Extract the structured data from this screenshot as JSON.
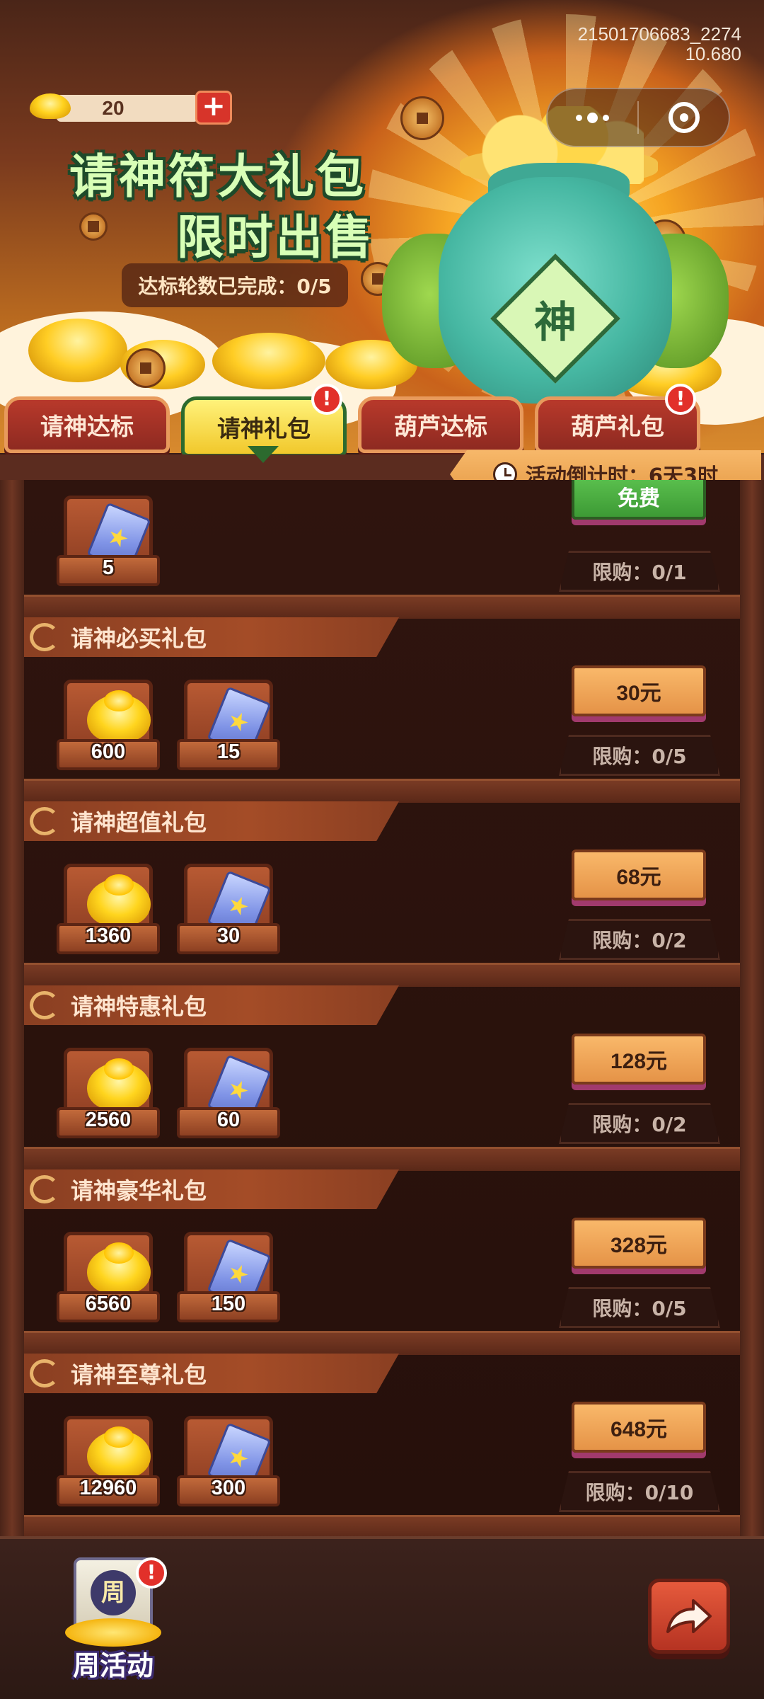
{
  "debug": {
    "line1": "21501706683_2274",
    "line2": "10.680"
  },
  "currency": {
    "amount": "20",
    "plus_label": "+"
  },
  "banner": {
    "title_line1": "请神符大礼包",
    "title_line2": "限时出售",
    "progress_text": "达标轮数已完成：0/5",
    "bag_label": "神"
  },
  "tabs": [
    {
      "label": "请神达标",
      "active": false,
      "alert": false
    },
    {
      "label": "请神礼包",
      "active": true,
      "alert": true
    },
    {
      "label": "葫芦达标",
      "active": false,
      "alert": false
    },
    {
      "label": "葫芦礼包",
      "active": false,
      "alert": true
    }
  ],
  "alert_mark": "!",
  "countdown": {
    "text": "活动倒计时：6天3时"
  },
  "free_pack": {
    "items": [
      {
        "icon": "talisman-icon",
        "count": "5"
      }
    ],
    "price": "免费",
    "limit": "限购：0/1"
  },
  "packs": [
    {
      "name": "请神必买礼包",
      "items": [
        {
          "icon": "gold-ingot-icon",
          "count": "600"
        },
        {
          "icon": "talisman-icon",
          "count": "15"
        }
      ],
      "price": "30元",
      "limit": "限购：0/5"
    },
    {
      "name": "请神超值礼包",
      "items": [
        {
          "icon": "gold-ingot-icon",
          "count": "1360"
        },
        {
          "icon": "talisman-icon",
          "count": "30"
        }
      ],
      "price": "68元",
      "limit": "限购：0/2"
    },
    {
      "name": "请神特惠礼包",
      "items": [
        {
          "icon": "gold-ingot-icon",
          "count": "2560"
        },
        {
          "icon": "talisman-icon",
          "count": "60"
        }
      ],
      "price": "128元",
      "limit": "限购：0/2"
    },
    {
      "name": "请神豪华礼包",
      "items": [
        {
          "icon": "gold-ingot-icon",
          "count": "6560"
        },
        {
          "icon": "talisman-icon",
          "count": "150"
        }
      ],
      "price": "328元",
      "limit": "限购：0/5"
    },
    {
      "name": "请神至尊礼包",
      "items": [
        {
          "icon": "gold-ingot-icon",
          "count": "12960"
        },
        {
          "icon": "talisman-icon",
          "count": "300"
        }
      ],
      "price": "648元",
      "limit": "限购：0/10"
    }
  ],
  "bottom": {
    "weekly_label": "周活动",
    "weekly_badge": "周"
  },
  "colors": {
    "active_tab": "#f1c82b",
    "tab": "#8e2a21",
    "price_button": "#e59347",
    "free_button": "#3d9a35",
    "alert": "#e2302a"
  }
}
